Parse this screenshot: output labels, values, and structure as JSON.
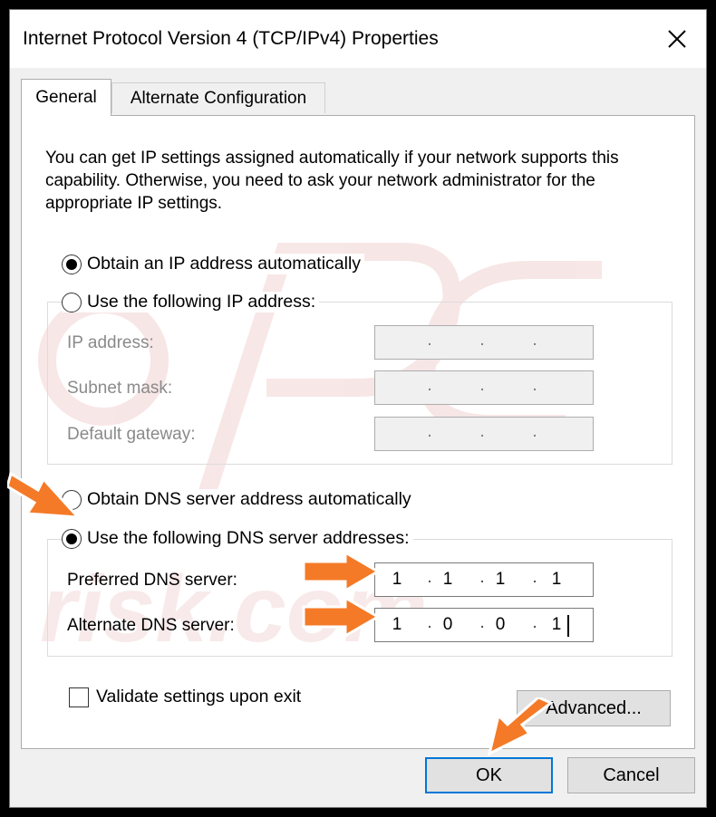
{
  "window": {
    "title": "Internet Protocol Version 4 (TCP/IPv4) Properties"
  },
  "tabs": [
    {
      "label": "General",
      "active": true
    },
    {
      "label": "Alternate Configuration",
      "active": false
    }
  ],
  "intro_text": "You can get IP settings assigned automatically if your network supports this capability. Otherwise, you need to ask your network administrator for the appropriate IP settings.",
  "ip_section": {
    "auto_label": "Obtain an IP address automatically",
    "auto_selected": true,
    "manual_label": "Use the following IP address:",
    "manual_selected": false,
    "fields": [
      {
        "label": "IP address:",
        "octets": [
          "",
          "",
          "",
          ""
        ],
        "enabled": false
      },
      {
        "label": "Subnet mask:",
        "octets": [
          "",
          "",
          "",
          ""
        ],
        "enabled": false
      },
      {
        "label": "Default gateway:",
        "octets": [
          "",
          "",
          "",
          ""
        ],
        "enabled": false
      }
    ]
  },
  "dns_section": {
    "auto_label": "Obtain DNS server address automatically",
    "auto_selected": false,
    "manual_label": "Use the following DNS server addresses:",
    "manual_selected": true,
    "fields": [
      {
        "label": "Preferred DNS server:",
        "octets": [
          "1",
          "1",
          "1",
          "1"
        ],
        "enabled": true
      },
      {
        "label": "Alternate DNS server:",
        "octets": [
          "1",
          "0",
          "0",
          "1"
        ],
        "enabled": true
      }
    ]
  },
  "validate": {
    "label": "Validate settings upon exit",
    "checked": false
  },
  "buttons": {
    "advanced": "Advanced...",
    "ok": "OK",
    "cancel": "Cancel"
  },
  "colors": {
    "arrow": "#f47a27",
    "focus": "#0078d7",
    "watermark": "#f3d5d5"
  }
}
